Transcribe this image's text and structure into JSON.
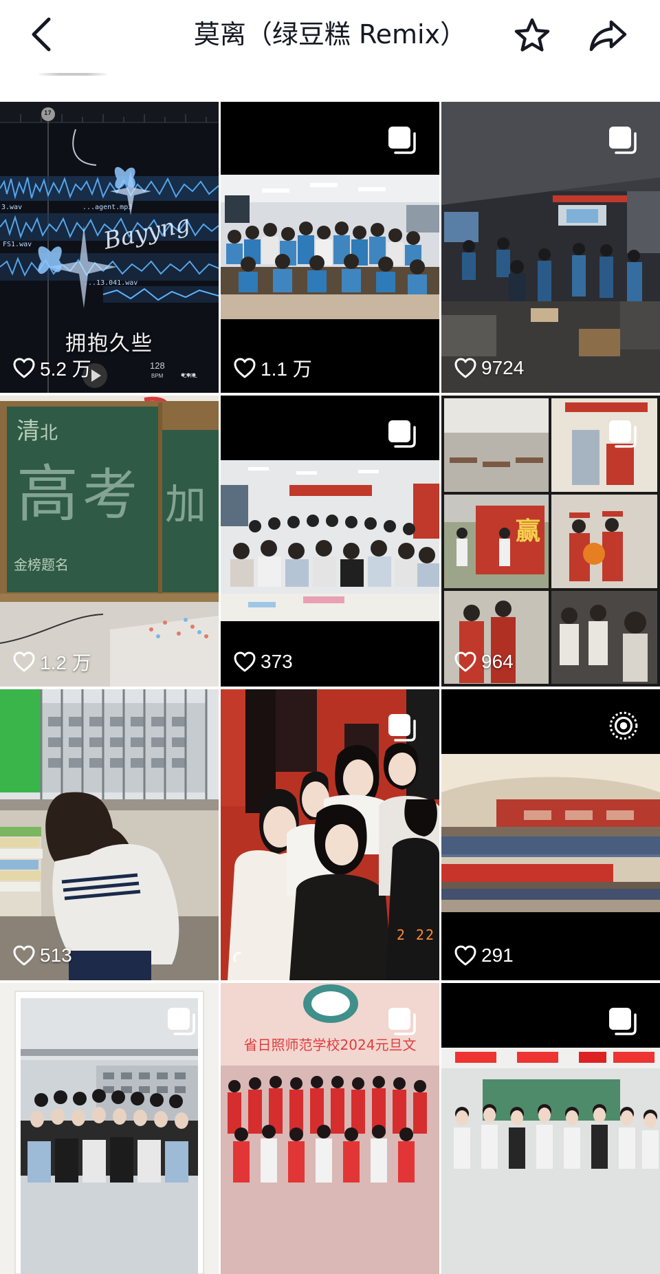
{
  "header": {
    "title": "莫离（绿豆糕 Remix）",
    "back_icon": "chevron-left-icon",
    "favorite_icon": "star-outline-icon",
    "share_icon": "share-arrow-icon"
  },
  "grid": {
    "items": [
      {
        "likes": "5.2 万",
        "badge": "none",
        "caption": "拥抱久些",
        "audio_files": [
          "3.wav",
          "...agent.mp3",
          "FS1.wav",
          "...13.041.wav"
        ],
        "playhead_label": "17",
        "bpm_value": "128",
        "bpm_label": "BPM",
        "ctrl_label": "CTRL",
        "signature": "Bayyng"
      },
      {
        "likes": "1.1 万",
        "badge": "image-set-icon"
      },
      {
        "likes": "9724",
        "badge": "image-set-icon"
      },
      {
        "likes": "1.2 万",
        "badge": "none"
      },
      {
        "likes": "373",
        "badge": "image-set-icon"
      },
      {
        "likes": "964",
        "badge": "image-set-icon",
        "poster_char": "赢"
      },
      {
        "likes": "513",
        "badge": "none"
      },
      {
        "likes": "",
        "badge": "image-set-icon",
        "timestamp": "2 22"
      },
      {
        "likes": "291",
        "badge": "live-photo-icon"
      },
      {
        "likes": "",
        "badge": "image-set-icon"
      },
      {
        "likes": "",
        "badge": "image-set-icon",
        "banner": "省日照师范学校2024元旦文"
      },
      {
        "likes": "",
        "badge": "image-set-icon"
      }
    ]
  },
  "colors": {
    "background": "#ffffff",
    "text": "#161823",
    "overlay_text": "#ffffff"
  }
}
